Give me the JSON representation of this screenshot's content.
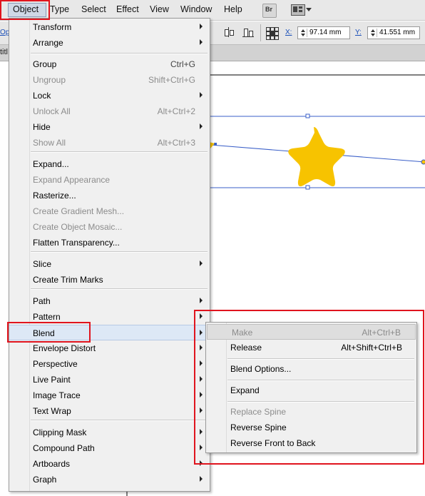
{
  "menubar": {
    "items": [
      "Object",
      "Type",
      "Select",
      "Effect",
      "View",
      "Window",
      "Help"
    ],
    "bridge_label": "Br"
  },
  "control_bar": {
    "x_label": "X:",
    "x_value": "97.14 mm",
    "y_label": "Y:",
    "y_value": "41.551 mm",
    "left_label": "Op"
  },
  "doc_tab": {
    "label": "titl"
  },
  "object_menu": {
    "items": [
      {
        "label": "Transform",
        "shortcut": "",
        "submenu": true,
        "enabled": true
      },
      {
        "label": "Arrange",
        "shortcut": "",
        "submenu": true,
        "enabled": true
      },
      {
        "label": "Group",
        "shortcut": "Ctrl+G",
        "submenu": false,
        "enabled": true
      },
      {
        "label": "Ungroup",
        "shortcut": "Shift+Ctrl+G",
        "submenu": false,
        "enabled": false
      },
      {
        "label": "Lock",
        "shortcut": "",
        "submenu": true,
        "enabled": true
      },
      {
        "label": "Unlock All",
        "shortcut": "Alt+Ctrl+2",
        "submenu": false,
        "enabled": false
      },
      {
        "label": "Hide",
        "shortcut": "",
        "submenu": true,
        "enabled": true
      },
      {
        "label": "Show All",
        "shortcut": "Alt+Ctrl+3",
        "submenu": false,
        "enabled": false
      },
      {
        "label": "Expand...",
        "shortcut": "",
        "submenu": false,
        "enabled": true
      },
      {
        "label": "Expand Appearance",
        "shortcut": "",
        "submenu": false,
        "enabled": false
      },
      {
        "label": "Rasterize...",
        "shortcut": "",
        "submenu": false,
        "enabled": true
      },
      {
        "label": "Create Gradient Mesh...",
        "shortcut": "",
        "submenu": false,
        "enabled": false
      },
      {
        "label": "Create Object Mosaic...",
        "shortcut": "",
        "submenu": false,
        "enabled": false
      },
      {
        "label": "Flatten Transparency...",
        "shortcut": "",
        "submenu": false,
        "enabled": true
      },
      {
        "label": "Slice",
        "shortcut": "",
        "submenu": true,
        "enabled": true
      },
      {
        "label": "Create Trim Marks",
        "shortcut": "",
        "submenu": false,
        "enabled": true
      },
      {
        "label": "Path",
        "shortcut": "",
        "submenu": true,
        "enabled": true
      },
      {
        "label": "Pattern",
        "shortcut": "",
        "submenu": true,
        "enabled": true
      },
      {
        "label": "Blend",
        "shortcut": "",
        "submenu": true,
        "enabled": true
      },
      {
        "label": "Envelope Distort",
        "shortcut": "",
        "submenu": true,
        "enabled": true
      },
      {
        "label": "Perspective",
        "shortcut": "",
        "submenu": true,
        "enabled": true
      },
      {
        "label": "Live Paint",
        "shortcut": "",
        "submenu": true,
        "enabled": true
      },
      {
        "label": "Image Trace",
        "shortcut": "",
        "submenu": true,
        "enabled": true
      },
      {
        "label": "Text Wrap",
        "shortcut": "",
        "submenu": true,
        "enabled": true
      },
      {
        "label": "Clipping Mask",
        "shortcut": "",
        "submenu": true,
        "enabled": true
      },
      {
        "label": "Compound Path",
        "shortcut": "",
        "submenu": true,
        "enabled": true
      },
      {
        "label": "Artboards",
        "shortcut": "",
        "submenu": true,
        "enabled": true
      },
      {
        "label": "Graph",
        "shortcut": "",
        "submenu": true,
        "enabled": true
      }
    ]
  },
  "blend_submenu": {
    "items": [
      {
        "label": "Make",
        "shortcut": "Alt+Ctrl+B",
        "enabled": false
      },
      {
        "label": "Release",
        "shortcut": "Alt+Shift+Ctrl+B",
        "enabled": true
      },
      {
        "label": "Blend Options...",
        "shortcut": "",
        "enabled": true
      },
      {
        "label": "Expand",
        "shortcut": "",
        "enabled": true
      },
      {
        "label": "Replace Spine",
        "shortcut": "",
        "enabled": false
      },
      {
        "label": "Reverse Spine",
        "shortcut": "",
        "enabled": true
      },
      {
        "label": "Reverse Front to Back",
        "shortcut": "",
        "enabled": true
      }
    ]
  },
  "colors": {
    "highlight_red": "#e0141e",
    "star_fill": "#f7c300",
    "selection_blue": "#3a5fc8"
  }
}
